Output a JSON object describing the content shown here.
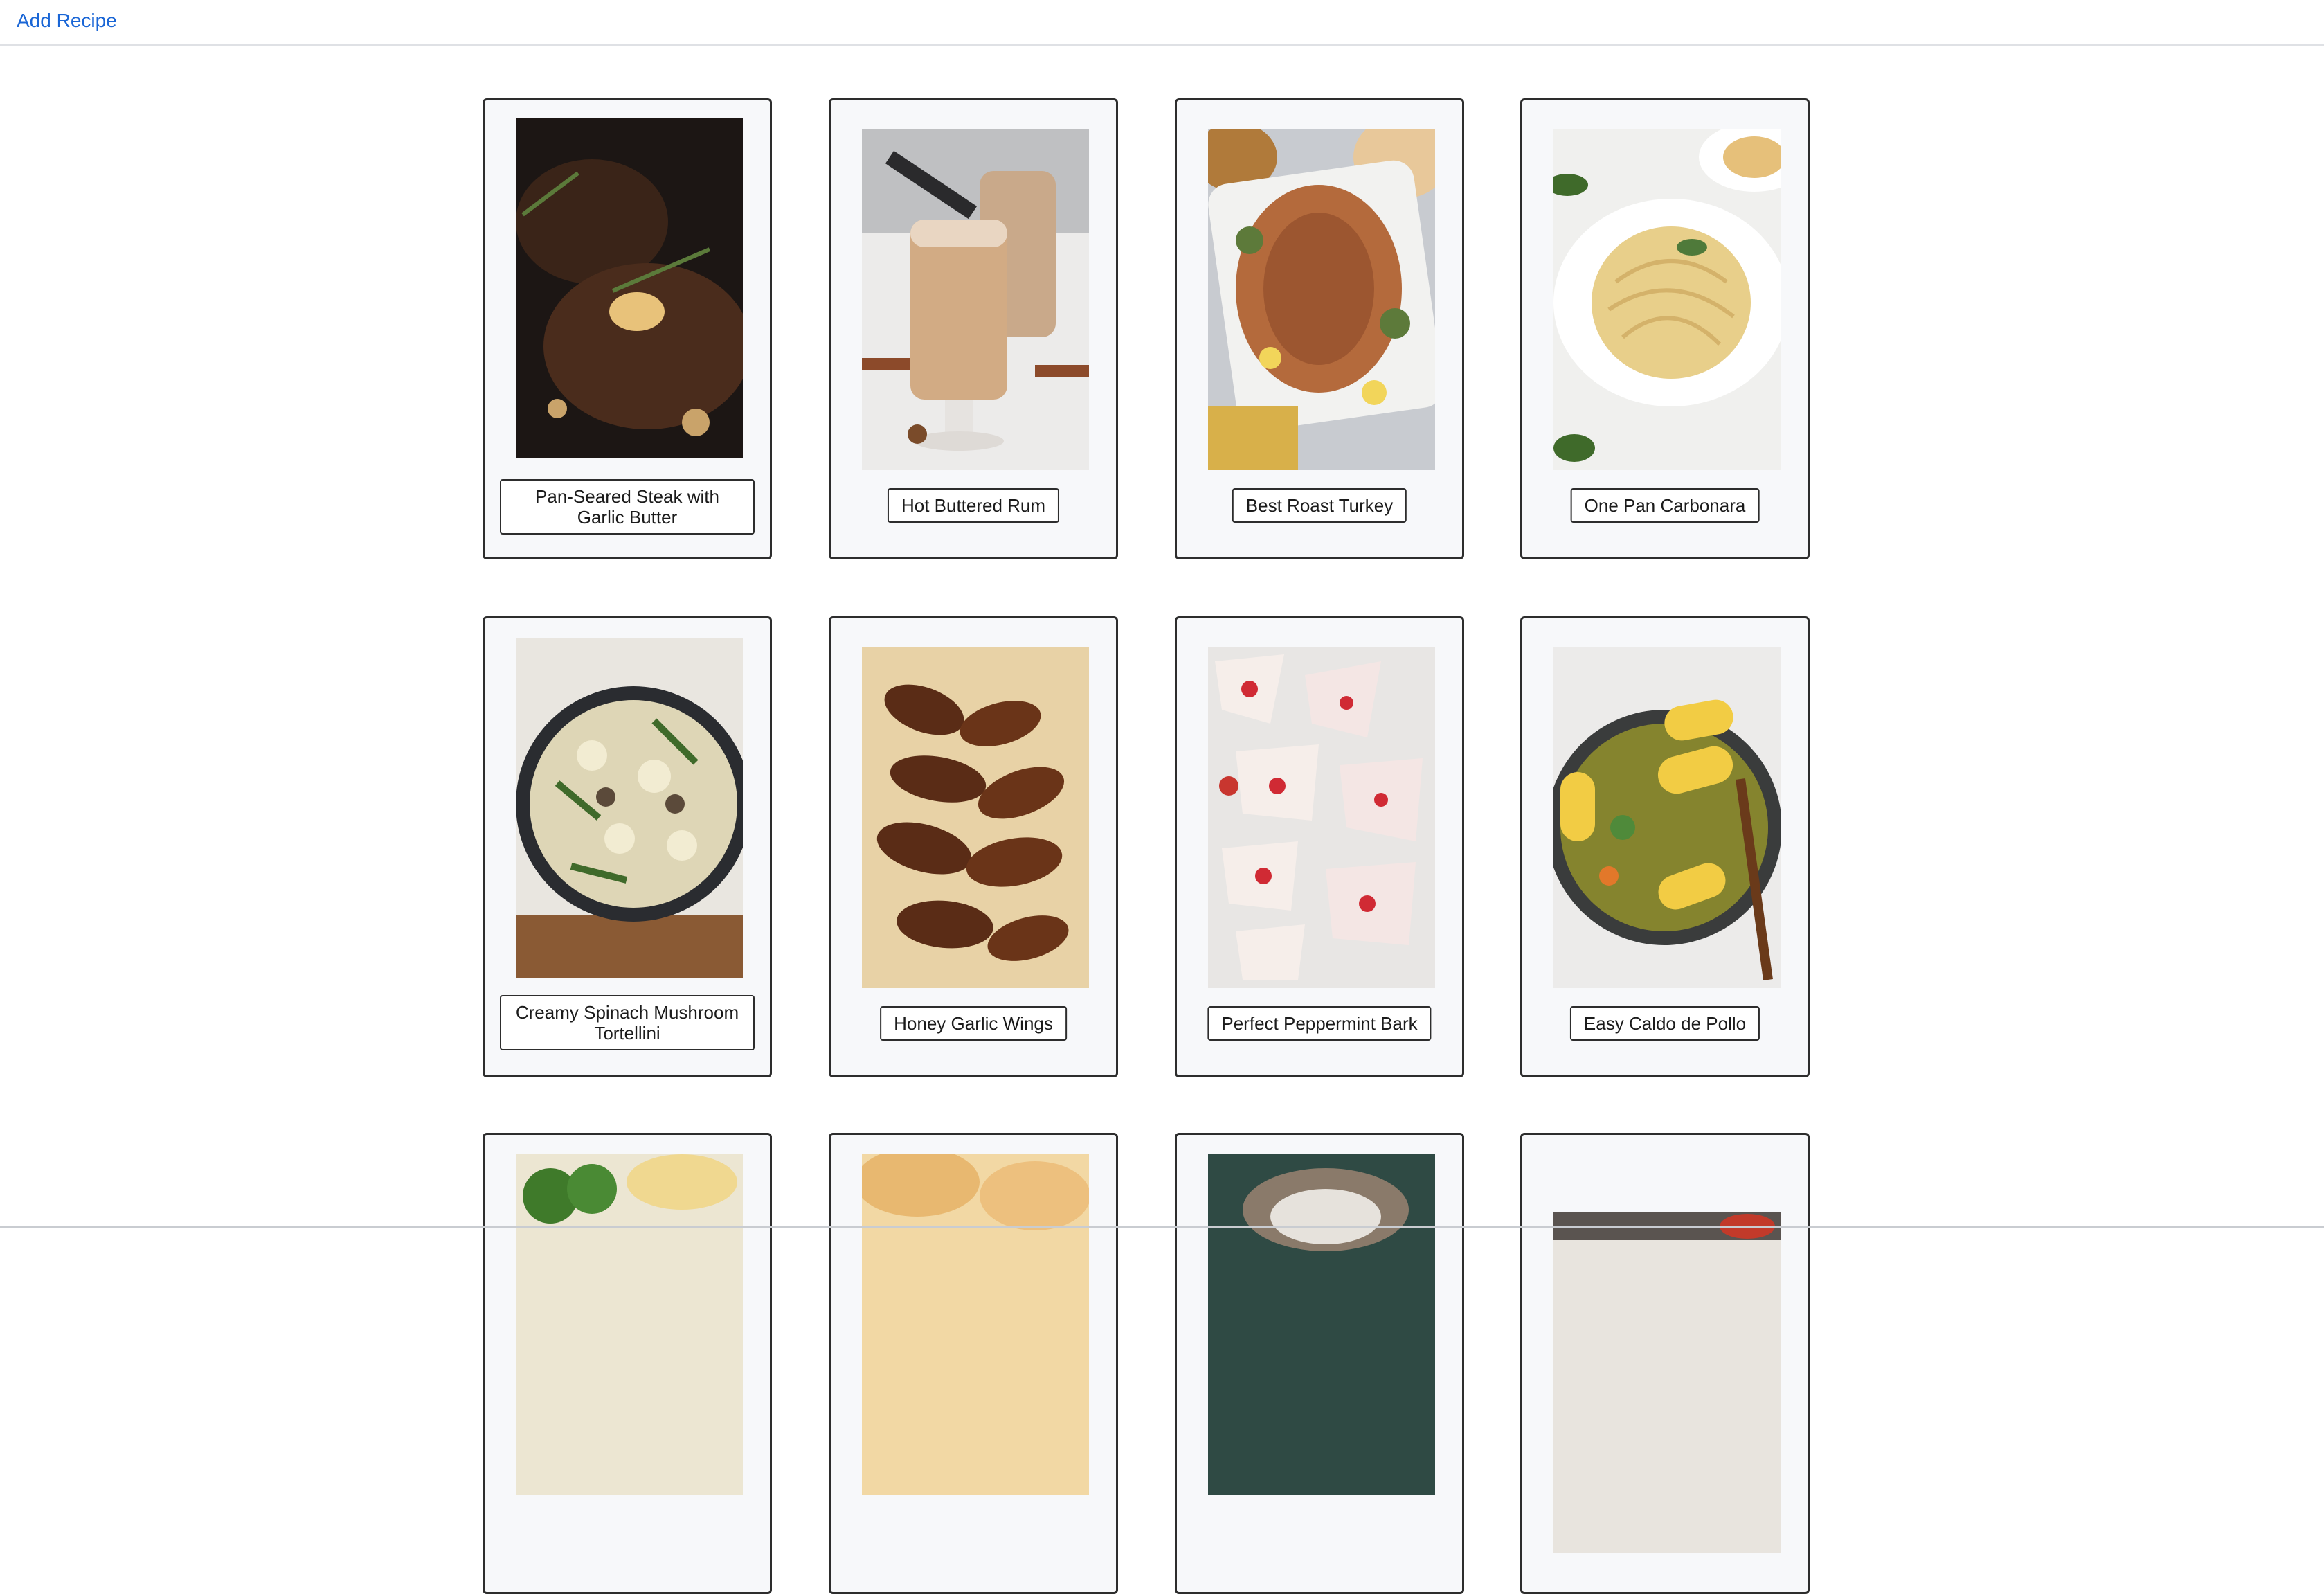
{
  "nav": {
    "add_recipe_label": "Add Recipe"
  },
  "colors": {
    "link": "#1a66d6",
    "card_bg": "#f7f8fa",
    "card_border": "#2d2d2d"
  },
  "recipes": [
    {
      "title": "Pan-Seared Steak with Garlic Butter",
      "image": "steak-photo"
    },
    {
      "title": "Hot Buttered Rum",
      "image": "drink-photo"
    },
    {
      "title": "Best Roast Turkey",
      "image": "turkey-photo"
    },
    {
      "title": "One Pan Carbonara",
      "image": "pasta-photo"
    },
    {
      "title": "Creamy Spinach Mushroom Tortellini",
      "image": "tortellini-photo"
    },
    {
      "title": "Honey Garlic Wings",
      "image": "wings-photo"
    },
    {
      "title": "Perfect Peppermint Bark",
      "image": "bark-photo"
    },
    {
      "title": "Easy Caldo de Pollo",
      "image": "soup-photo"
    },
    {
      "title": "",
      "image": "broccoli-photo"
    },
    {
      "title": "",
      "image": "bread-photo"
    },
    {
      "title": "",
      "image": "basket-photo"
    },
    {
      "title": "",
      "image": "dish-photo"
    }
  ]
}
